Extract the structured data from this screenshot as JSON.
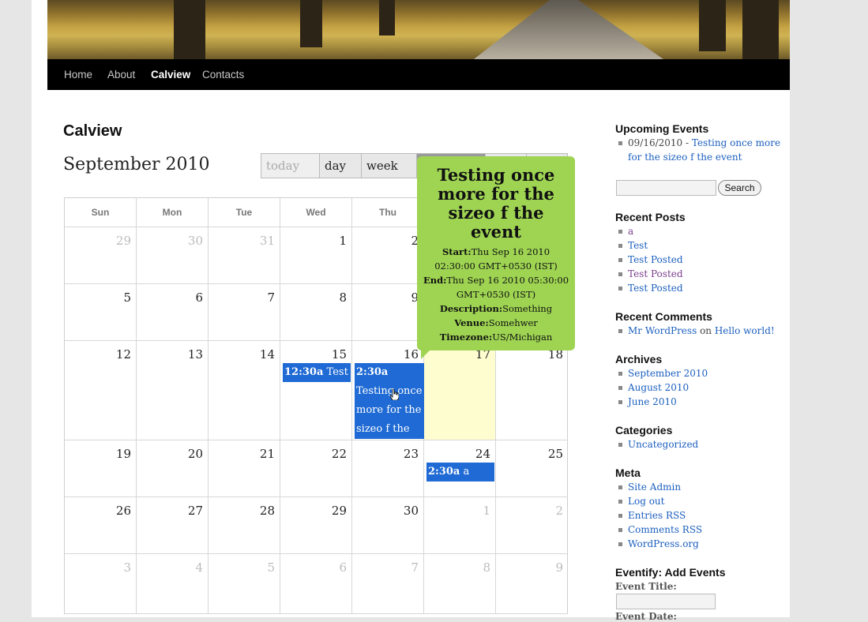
{
  "nav": {
    "items": [
      "Home",
      "About",
      "Calview",
      "Contacts"
    ],
    "active": "Calview"
  },
  "page_title": "Calview",
  "calendar": {
    "month_title": "September 2010",
    "buttons": {
      "today": "today",
      "day": "day",
      "week": "week"
    },
    "weekdays": [
      "Sun",
      "Mon",
      "Tue",
      "Wed",
      "Thu"
    ],
    "weeks": [
      [
        "29",
        "30",
        "31",
        "1",
        "2",
        "",
        ""
      ],
      [
        "5",
        "6",
        "7",
        "8",
        "9",
        "",
        ""
      ],
      [
        "12",
        "13",
        "14",
        "15",
        "16",
        "17",
        "18"
      ],
      [
        "19",
        "20",
        "21",
        "22",
        "23",
        "24",
        "25"
      ],
      [
        "26",
        "27",
        "28",
        "29",
        "30",
        "1",
        "2"
      ],
      [
        "3",
        "4",
        "5",
        "6",
        "7",
        "8",
        "9"
      ]
    ],
    "events": [
      {
        "time": "12:30a",
        "title": "Test"
      },
      {
        "time": "2:30a",
        "title": "Testing once more for the sizeo f the event"
      },
      {
        "time": "2:30a",
        "title": "a"
      }
    ]
  },
  "tooltip": {
    "title": "Testing once more for the sizeo f the event",
    "start_label": "Start:",
    "start_value": "Thu Sep 16 2010 02:30:00 GMT+0530 (IST)",
    "end_label": "End:",
    "end_value": "Thu Sep 16 2010 05:30:00 GMT+0530 (IST)",
    "desc_label": "Description:",
    "desc_value": "Something",
    "venue_label": "Venue:",
    "venue_value": "Somehwer",
    "tz_label": "Timezone:",
    "tz_value": "US/Michigan"
  },
  "sidebar": {
    "upcoming_head": "Upcoming Events",
    "upcoming_date": "09/16/2010 -",
    "upcoming_link_1": "Testing once more",
    "upcoming_link_2": "for the sizeo f the event",
    "search_button": "Search",
    "recent_posts_head": "Recent Posts",
    "recent_posts": [
      "a",
      "Test",
      "Test Posted",
      "Test Posted",
      "Test Posted"
    ],
    "recent_comments_head": "Recent Comments",
    "comment_author": "Mr WordPress",
    "comment_on": "on",
    "comment_post": "Hello world!",
    "archives_head": "Archives",
    "archives": [
      "September 2010",
      "August 2010",
      "June 2010"
    ],
    "categories_head": "Categories",
    "categories": [
      "Uncategorized"
    ],
    "meta_head": "Meta",
    "meta": [
      "Site Admin",
      "Log out",
      "Entries RSS",
      "Comments RSS",
      "WordPress.org"
    ],
    "eventify_head": "Eventify: Add Events",
    "event_title_label": "Event Title:",
    "event_date_label": "Event Date:"
  }
}
